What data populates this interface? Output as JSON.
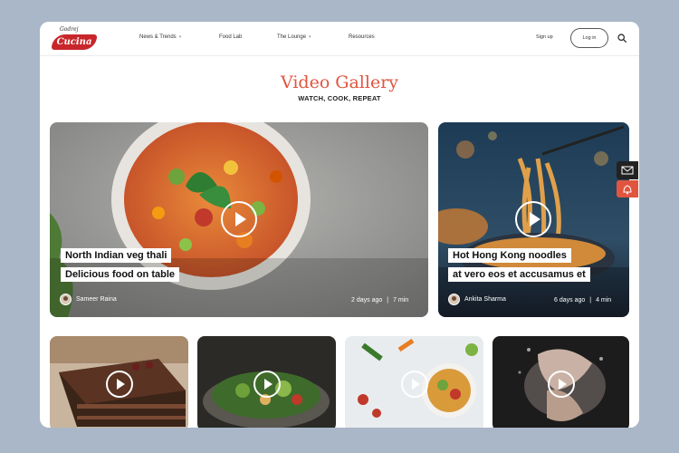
{
  "header": {
    "logo_small": "Godrej",
    "logo_brand": "Cucina",
    "nav": [
      {
        "label": "News & Trends",
        "has_dropdown": true
      },
      {
        "label": "Food Lab",
        "has_dropdown": false
      },
      {
        "label": "The Lounge",
        "has_dropdown": true
      },
      {
        "label": "Resources",
        "has_dropdown": false
      }
    ],
    "signup": "Sign up",
    "login": "Log in",
    "search_icon": "search-icon"
  },
  "gallery": {
    "title": "Video Gallery",
    "subtitle": "WATCH, COOK, REPEAT"
  },
  "featured": [
    {
      "caption_line1": "North Indian veg thali",
      "caption_line2": "Delicious food on table",
      "author": "Sameer Raina",
      "age": "2 days ago",
      "separator": "|",
      "duration": "7 min"
    },
    {
      "caption_line1": "Hot Hong Kong noodles",
      "caption_line2": "at vero eos et accusamus et",
      "author": "Ankita Sharma",
      "age": "6 days ago",
      "separator": "|",
      "duration": "4 min"
    }
  ],
  "thumbnails": [
    {
      "subject": "chocolate cake slice"
    },
    {
      "subject": "green salad bowl"
    },
    {
      "subject": "vegetables and grain bowl"
    },
    {
      "subject": "hands kneading dough"
    }
  ],
  "side_widgets": {
    "mail_icon": "mail-icon",
    "alert_icon": "bell-icon"
  },
  "colors": {
    "accent": "#e0553f",
    "brand_red": "#c8262b",
    "backdrop": "#a9b7c8"
  }
}
